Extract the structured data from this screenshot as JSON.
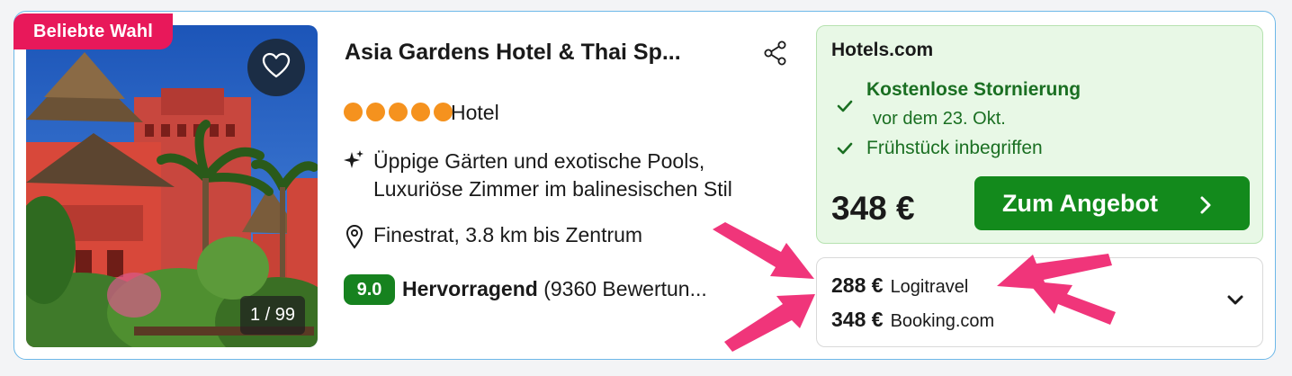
{
  "badge": "Beliebte Wahl",
  "photo": {
    "counter": "1 / 99"
  },
  "icons": {
    "favorite": "heart-icon",
    "share": "share-icon",
    "sparkle": "sparkle-icon",
    "location": "location-pin-icon",
    "check": "check-icon",
    "chevron_right": "chevron-right-icon",
    "chevron_down": "chevron-down-icon"
  },
  "hotel": {
    "name": "Asia Gardens Hotel & Thai Sp...",
    "stars": 5,
    "type": "Hotel",
    "highlights": [
      "Üppige Gärten und exotische Pools,",
      "Luxuriöse Zimmer im balinesischen Stil"
    ],
    "location": "Finestrat, 3.8 km bis Zentrum",
    "rating": {
      "score": "9.0",
      "label": "Hervorragend",
      "count": "(9360 Bewertun..."
    }
  },
  "offer": {
    "provider": "Hotels.com",
    "perk_cancellation": "Kostenlose Stornierung",
    "perk_cancellation_detail": "vor dem 23. Okt.",
    "perk_breakfast": "Frühstück inbegriffen",
    "price": "348 €",
    "cta": "Zum Angebot"
  },
  "alternatives": [
    {
      "price": "288 €",
      "provider": "Logitravel"
    },
    {
      "price": "348 €",
      "provider": "Booking.com"
    }
  ],
  "colors": {
    "accent_green": "#138a1c",
    "badge_pink": "#e8185a",
    "annotation_arrow": "#f0357a",
    "star_orange": "#f5921e",
    "card_border": "#6db8e8"
  }
}
